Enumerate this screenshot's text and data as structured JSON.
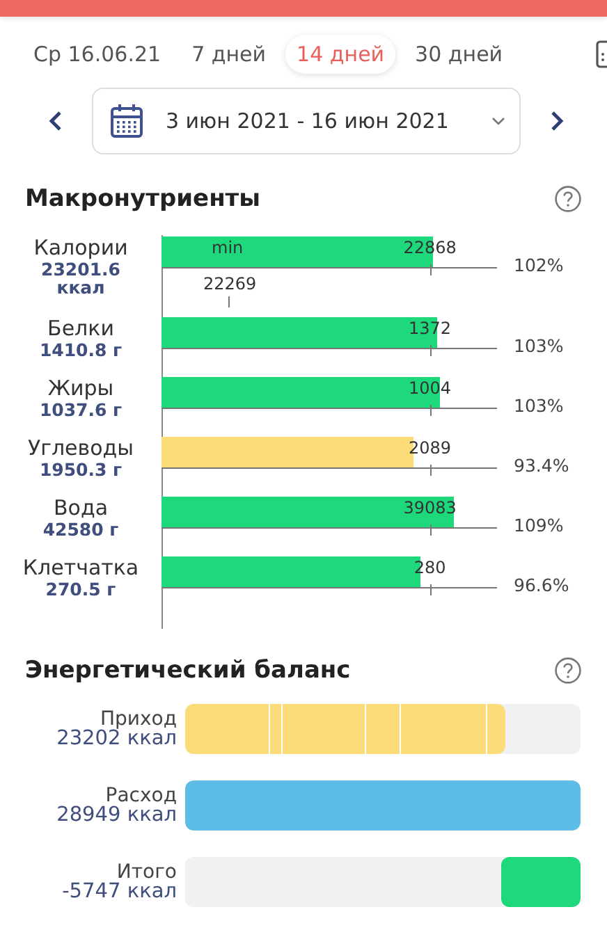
{
  "tabs": [
    {
      "label": "Ср 16.06.21",
      "selected": false
    },
    {
      "label": "7 дней",
      "selected": false
    },
    {
      "label": "14 дней",
      "selected": true
    },
    {
      "label": "30 дней",
      "selected": false
    }
  ],
  "date_range": {
    "label": "3 июн 2021 - 16 июн 2021"
  },
  "macronutrients": {
    "title": "Макронутриенты",
    "rows": [
      {
        "name": "Калории",
        "amount": "23201.6 ккал",
        "target": "22868",
        "percent": "102%",
        "level": 0.81,
        "color": "#1ed97c",
        "min_label": "min",
        "min_value": "22269"
      },
      {
        "name": "Белки",
        "amount": "1410.8 г",
        "target": "1372",
        "percent": "103%",
        "level": 0.82,
        "color": "#1ed97c"
      },
      {
        "name": "Жиры",
        "amount": "1037.6 г",
        "target": "1004",
        "percent": "103%",
        "level": 0.83,
        "color": "#1ed97c"
      },
      {
        "name": "Углеводы",
        "amount": "1950.3 г",
        "target": "2089",
        "percent": "93.4%",
        "level": 0.75,
        "color": "#fbdc79"
      },
      {
        "name": "Вода",
        "amount": "42580 г",
        "target": "39083",
        "percent": "109%",
        "level": 0.87,
        "color": "#1ed97c"
      },
      {
        "name": "Клетчатка",
        "amount": "270.5 г",
        "target": "280",
        "percent": "96.6%",
        "level": 0.77,
        "color": "#1ed97c"
      }
    ]
  },
  "energy_balance": {
    "title": "Энергетический баланс",
    "rows": [
      {
        "label": "Приход",
        "value": "23202 ккал",
        "kind": "segmented",
        "color": "#fbdc79"
      },
      {
        "label": "Расход",
        "value": "28949 ккал",
        "kind": "bar",
        "color": "#5dbde6",
        "level": 1
      },
      {
        "label": "Итого",
        "value": "-5747 ккал",
        "kind": "end",
        "color": "#1ed97c",
        "level": 0.2
      }
    ]
  }
}
